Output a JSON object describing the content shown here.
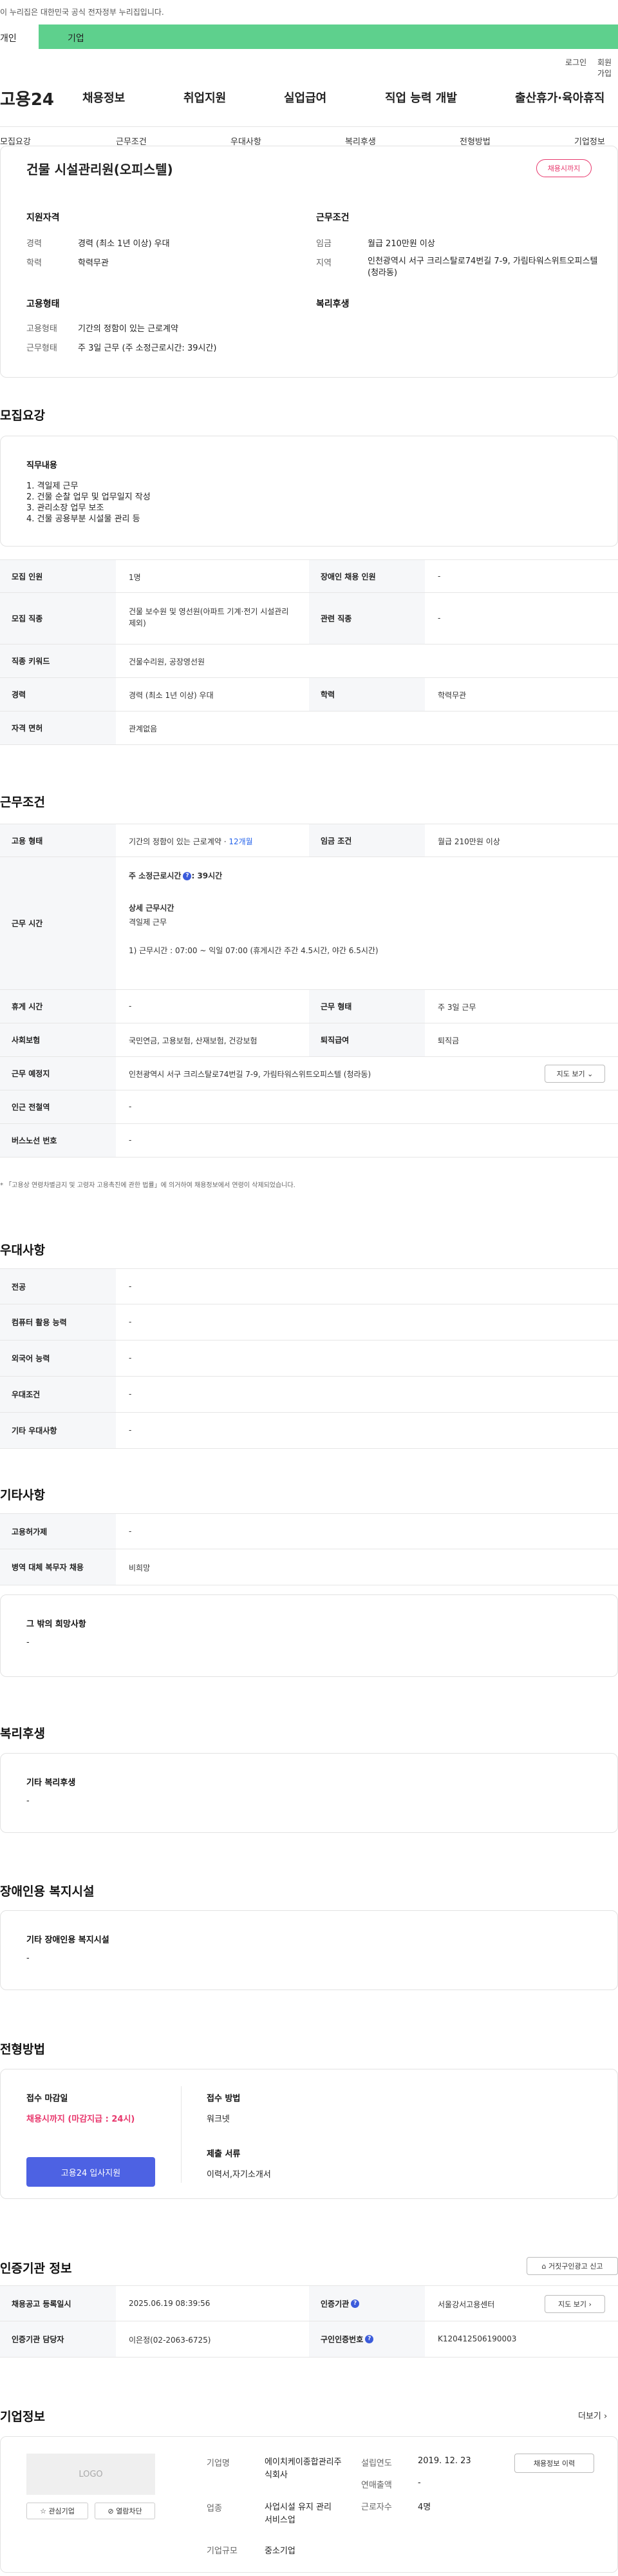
{
  "header": {
    "notice": "이 누리집은 대한민국 공식 전자정부 누리집입니다.",
    "user_tab": "개인",
    "biz_tab": "기업",
    "login": "로그인",
    "join": "회원가입",
    "logo": "고용24",
    "gnb": [
      "채용정보",
      "취업지원",
      "실업급여",
      "직업 능력 개발",
      "출산휴가·육아휴직"
    ]
  },
  "tabs": [
    "모집요강",
    "근무조건",
    "우대사항",
    "복리후생",
    "전형방법",
    "기업정보"
  ],
  "summary": {
    "title": "건물 시설관리원(오피스텔)",
    "badge": "채용시까지",
    "qual_title": "지원자격",
    "career_label": "경력",
    "career": "경력 (최소 1년 이상) 우대",
    "edu_label": "학력",
    "edu": "학력무관",
    "cond_title": "근무조건",
    "wage_label": "임금",
    "wage": "월급 210만원 이상",
    "region_label": "지역",
    "region": "인천광역시 서구 크리스탈로74번길 7-9, 가림타워스위트오피스텔 (청라동)",
    "emp_title": "고용형태",
    "emp_type_label": "고용형태",
    "emp_type": "기간의 정함이 있는 근로계약",
    "work_label": "근무형태",
    "work": "주 3일 근무 (주 소정근로시간: 39시간)",
    "welfare_title": "복리후생"
  },
  "recruit": {
    "heading": "모집요강",
    "duty_title": "직무내용",
    "duties": [
      "1. 격일제 근무",
      "2. 건물 순찰 업무 및 업무일지 작성",
      "3. 관리소장 업무 보조",
      "4. 건물 공용부분 시설물 관리 등"
    ],
    "rows": [
      {
        "th1": "모집 인원",
        "td1": "1명",
        "th2": "장애인 채용 인원",
        "td2": "-"
      },
      {
        "th1": "모집 직종",
        "td1": "건물 보수원 및 영선원(아파트 기계·전기 시설관리 제외)",
        "th2": "관련 직종",
        "td2": "-"
      },
      {
        "th1": "직종 키워드",
        "td1": "건물수리원, 공장영선원"
      },
      {
        "th1": "경력",
        "td1": "경력 (최소 1년 이상) 우대",
        "th2": "학력",
        "td2": "학력무관"
      },
      {
        "th1": "자격 면허",
        "td1": "관계없음"
      }
    ]
  },
  "work": {
    "heading": "근무조건",
    "emp_th": "고용 형태",
    "emp_td": "기간의 정함이 있는 근로계약 · ",
    "emp_months": "12개월",
    "wage_th": "임금 조건",
    "wage_td": "월급 210만원 이상",
    "time_th": "근무 시간",
    "week_hours_label": "주 소정근로시간",
    "week_hours": ": 39시간",
    "detail_label": "상세 근무시간",
    "detail_type": "격일제 근무",
    "detail_time": "1) 근무시간 : 07:00 ~ 익일 07:00 (휴게시간 주간 4.5시간, 야간 6.5시간)",
    "rest_th": "휴게 시간",
    "rest_td": "-",
    "form_th": "근무 형태",
    "form_td": "주 3일 근무",
    "ins_th": "사회보험",
    "ins_td": "국민연금, 고용보험, 산재보험, 건강보험",
    "retire_th": "퇴직급여",
    "retire_td": "퇴직금",
    "place_th": "근무 예정지",
    "place_td": "인천광역시 서구 크리스탈로74번길 7-9, 가림타워스위트오피스텔 (청라동)",
    "map_btn": "지도 보기",
    "subway_th": "인근 전철역",
    "subway_td": "-",
    "bus_th": "버스노선 번호",
    "bus_td": "-",
    "note": "* 「고용상 연령차별금지 및 고령자 고용촉진에 관한 법률」에 의거하여 채용정보에서 연령이 삭제되었습니다."
  },
  "pref": {
    "heading": "우대사항",
    "rows": [
      {
        "th": "전공",
        "td": "-"
      },
      {
        "th": "컴퓨터 활용 능력",
        "td": "-"
      },
      {
        "th": "외국어 능력",
        "td": "-"
      },
      {
        "th": "우대조건",
        "td": "-"
      },
      {
        "th": "기타 우대사항",
        "td": "-"
      }
    ]
  },
  "etc": {
    "heading": "기타사항",
    "rows": [
      {
        "th": "고용허가제",
        "td": "-"
      },
      {
        "th": "병역 대체 복무자 채용",
        "td": "비희망"
      }
    ],
    "other_title": "그 밖의 희망사항",
    "other": "-"
  },
  "welfare": {
    "heading": "복리후생",
    "title": "기타 복리후생",
    "value": "-"
  },
  "disabled": {
    "heading": "장애인용 복지시설",
    "title": "기타 장애인용 복지시설",
    "value": "-"
  },
  "process": {
    "heading": "전형방법",
    "deadline_title": "접수 마감일",
    "deadline": "채용시까지 (마감지급 : 24시)",
    "apply_btn": "고용24 입사지원",
    "method_title": "접수 방법",
    "method": "워크넷",
    "docs_title": "제출 서류",
    "docs": "이력서,자기소개서"
  },
  "agency": {
    "heading": "인증기관 정보",
    "report_btn": "거짓구인광고 신고",
    "reg_th": "채용공고 등록일시",
    "reg_td": "2025.06.19 08:39:56",
    "agency_th": "인증기관",
    "agency_td": "서울강서고용센터",
    "map_btn": "지도 보기",
    "staff_th": "인증기관 담당자",
    "staff_td": "이은정(02-2063-6725)",
    "num_th": "구인인증번호",
    "num_td": "K120412506190003"
  },
  "company": {
    "heading": "기업정보",
    "more": "더보기",
    "logo": "LOGO",
    "fav_btn": "관심기업",
    "block_btn": "열람차단",
    "name_label": "기업명",
    "name": "에이치케이종합관리주식회사",
    "industry_label": "업종",
    "industry": "사업시설 유지 관리 서비스업",
    "size_label": "기업규모",
    "size": "중소기업",
    "founded_label": "설립연도",
    "founded": "2019. 12. 23",
    "sales_label": "연매출액",
    "sales": "-",
    "emp_label": "근로자수",
    "emp": "4명",
    "jobs_btn": "채용정보 이력"
  }
}
